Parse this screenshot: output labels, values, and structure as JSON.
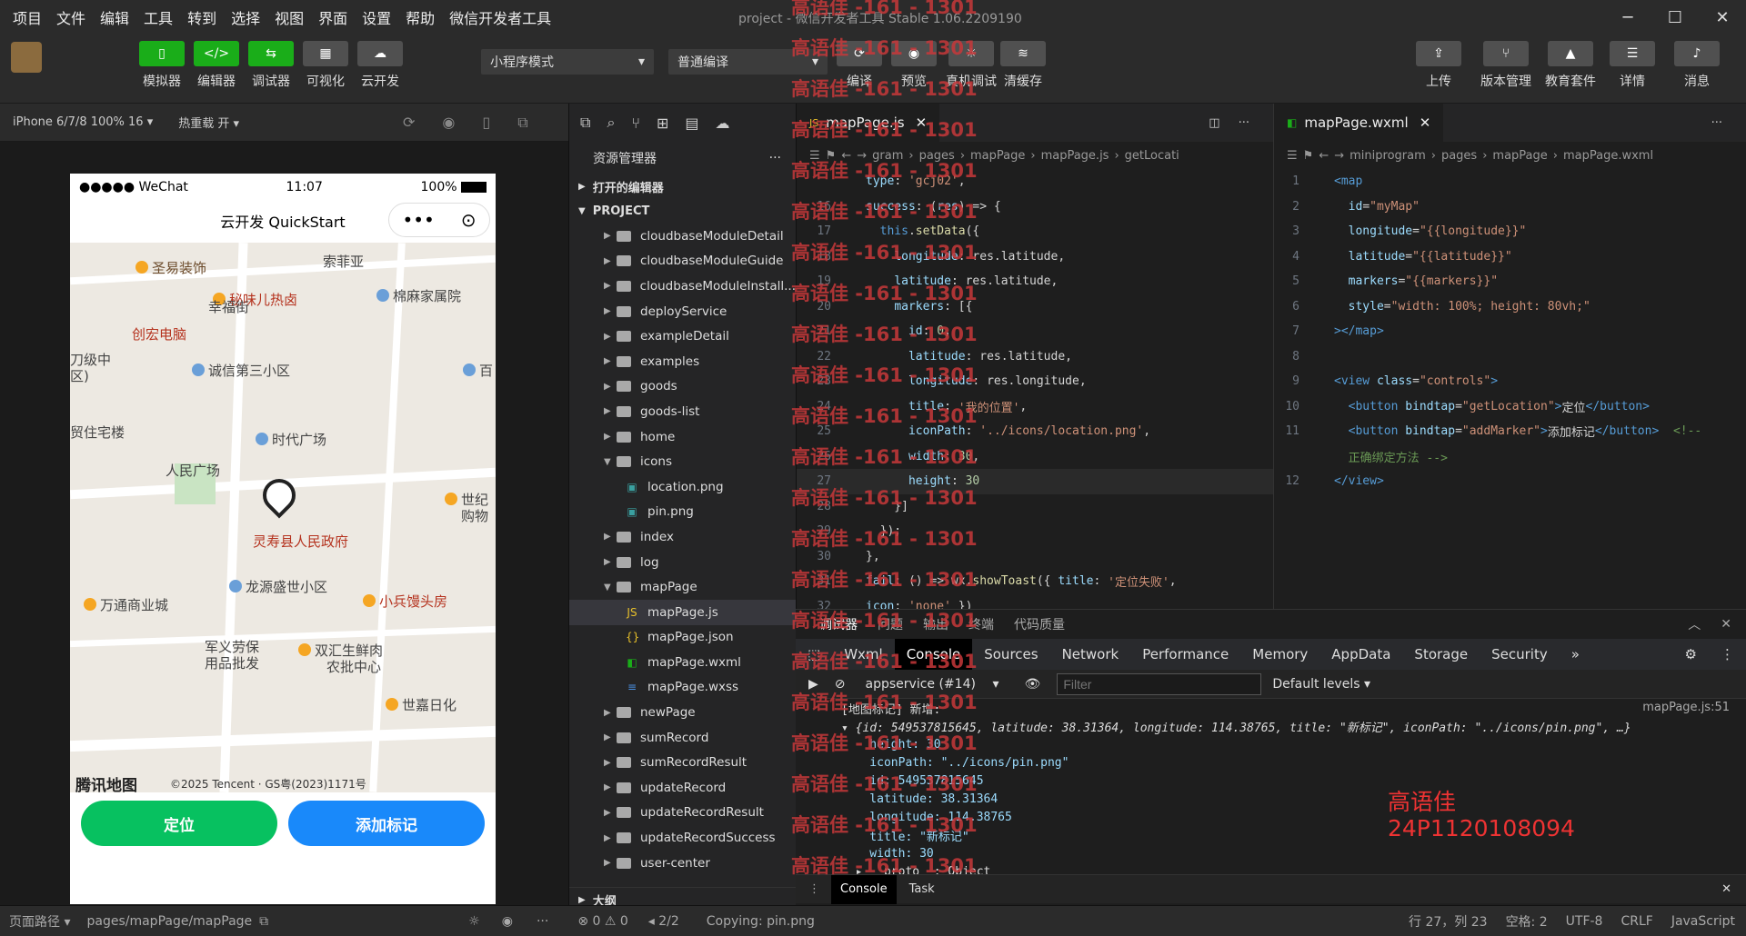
{
  "menubar": {
    "items": [
      "项目",
      "文件",
      "编辑",
      "工具",
      "转到",
      "选择",
      "视图",
      "界面",
      "设置",
      "帮助",
      "微信开发者工具"
    ],
    "window_title": "project - 微信开发者工具 Stable 1.06.2209190"
  },
  "toolbar": {
    "left_buttons": [
      {
        "label": "模拟器",
        "icon": "phone-icon"
      },
      {
        "label": "编辑器",
        "icon": "code-icon"
      },
      {
        "label": "调试器",
        "icon": "debug-icon"
      },
      {
        "label": "可视化",
        "icon": "layout-icon"
      },
      {
        "label": "云开发",
        "icon": "cloud-icon"
      }
    ],
    "mode_select": "小程序模式",
    "compile_select": "普通编译",
    "middle_buttons": [
      {
        "label": "编译",
        "icon": "refresh-icon"
      },
      {
        "label": "预览",
        "icon": "eye-icon"
      },
      {
        "label": "真机调试",
        "icon": "bug-icon"
      },
      {
        "label": "清缓存",
        "icon": "layers-icon"
      }
    ],
    "right_buttons": [
      {
        "label": "上传",
        "icon": "upload-icon"
      },
      {
        "label": "版本管理",
        "icon": "branch-icon"
      },
      {
        "label": "教育套件",
        "icon": "cap-icon"
      },
      {
        "label": "详情",
        "icon": "menu-icon"
      },
      {
        "label": "消息",
        "icon": "bell-icon"
      }
    ]
  },
  "simulator": {
    "device": "iPhone 6/7/8 100% 16 ▾",
    "hot_reload": "热重载 开 ▾",
    "status_left": "●●●●● WeChat",
    "status_time": "11:07",
    "status_batt": "100%",
    "nav_title": "云开发 QuickStart",
    "map_pois": [
      "圣易装饰",
      "索菲亚",
      "秘味儿热卤",
      "棉麻家属院",
      "幸福街",
      "创宏电脑",
      "刀级中",
      "区)",
      "诚信第三小区",
      "百",
      "贸住宅楼",
      "时代广场",
      "人民广场",
      "世纪",
      "购物",
      "灵寿县人民政府",
      "龙源盛世小区",
      "小兵馒头房",
      "万通商业城",
      "军义劳保",
      "用品批发",
      "双汇生鲜肉",
      "农批中心",
      "世嘉日化"
    ],
    "map_logo": "腾讯地图",
    "map_copyright": "©2025 Tencent · GS粤(2023)1171号",
    "btn_locate": "定位",
    "btn_add": "添加标记",
    "btn_locate_color": "#07c160",
    "btn_add_color": "#1989fa"
  },
  "explorer": {
    "title": "资源管理器",
    "open_editors": "打开的编辑器",
    "project": "PROJECT",
    "items": [
      {
        "name": "cloudbaseModuleDetail",
        "type": "folder",
        "indent": 1,
        "arrow": "▶"
      },
      {
        "name": "cloudbaseModuleGuide",
        "type": "folder",
        "indent": 1,
        "arrow": "▶"
      },
      {
        "name": "cloudbaseModuleInstall...",
        "type": "folder",
        "indent": 1,
        "arrow": "▶"
      },
      {
        "name": "deployService",
        "type": "folder",
        "indent": 1,
        "arrow": "▶"
      },
      {
        "name": "exampleDetail",
        "type": "folder",
        "indent": 1,
        "arrow": "▶"
      },
      {
        "name": "examples",
        "type": "folder",
        "indent": 1,
        "arrow": "▶"
      },
      {
        "name": "goods",
        "type": "folder",
        "indent": 1,
        "arrow": "▶"
      },
      {
        "name": "goods-list",
        "type": "folder",
        "indent": 1,
        "arrow": "▶"
      },
      {
        "name": "home",
        "type": "folder",
        "indent": 1,
        "arrow": "▶"
      },
      {
        "name": "icons",
        "type": "folder",
        "indent": 1,
        "arrow": "▼"
      },
      {
        "name": "location.png",
        "type": "img",
        "indent": 2,
        "arrow": ""
      },
      {
        "name": "pin.png",
        "type": "img",
        "indent": 2,
        "arrow": ""
      },
      {
        "name": "index",
        "type": "folder",
        "indent": 1,
        "arrow": "▶"
      },
      {
        "name": "log",
        "type": "folder",
        "indent": 1,
        "arrow": "▶"
      },
      {
        "name": "mapPage",
        "type": "folder",
        "indent": 1,
        "arrow": "▼"
      },
      {
        "name": "mapPage.js",
        "type": "js",
        "indent": 2,
        "arrow": ""
      },
      {
        "name": "mapPage.json",
        "type": "json",
        "indent": 2,
        "arrow": ""
      },
      {
        "name": "mapPage.wxml",
        "type": "wxml",
        "indent": 2,
        "arrow": ""
      },
      {
        "name": "mapPage.wxss",
        "type": "wxss",
        "indent": 2,
        "arrow": ""
      },
      {
        "name": "newPage",
        "type": "folder",
        "indent": 1,
        "arrow": "▶"
      },
      {
        "name": "sumRecord",
        "type": "folder",
        "indent": 1,
        "arrow": "▶"
      },
      {
        "name": "sumRecordResult",
        "type": "folder",
        "indent": 1,
        "arrow": "▶"
      },
      {
        "name": "updateRecord",
        "type": "folder",
        "indent": 1,
        "arrow": "▶"
      },
      {
        "name": "updateRecordResult",
        "type": "folder",
        "indent": 1,
        "arrow": "▶"
      },
      {
        "name": "updateRecordSuccess",
        "type": "folder",
        "indent": 1,
        "arrow": "▶"
      },
      {
        "name": "user-center",
        "type": "folder",
        "indent": 1,
        "arrow": "▶"
      }
    ],
    "outline": "大纲"
  },
  "editor1": {
    "tab": "mapPage.js",
    "crumbs": [
      "gram",
      "pages",
      "mapPage",
      "mapPage.js",
      "getLocati"
    ],
    "lines": [
      {
        "n": "",
        "code": [
          [
            "prop",
            "type"
          ],
          [
            "txt",
            ": "
          ],
          [
            "str",
            "'gcj02'"
          ],
          [
            "txt",
            ","
          ]
        ]
      },
      {
        "n": "16",
        "code": [
          [
            "prop",
            "success"
          ],
          [
            "txt",
            ": ("
          ],
          [
            "prop",
            "res"
          ],
          [
            "txt",
            ") => {"
          ]
        ]
      },
      {
        "n": "17",
        "code": [
          [
            "txt",
            "  "
          ],
          [
            "kw",
            "this"
          ],
          [
            "txt",
            "."
          ],
          [
            "fn",
            "setData"
          ],
          [
            "txt",
            "({"
          ]
        ]
      },
      {
        "n": "18",
        "code": [
          [
            "txt",
            "    "
          ],
          [
            "prop",
            "longitude"
          ],
          [
            "txt",
            ": res.latitude,"
          ]
        ]
      },
      {
        "n": "19",
        "code": [
          [
            "txt",
            "    "
          ],
          [
            "prop",
            "latitude"
          ],
          [
            "txt",
            ": res.latitude,"
          ]
        ]
      },
      {
        "n": "20",
        "code": [
          [
            "txt",
            "    "
          ],
          [
            "prop",
            "markers"
          ],
          [
            "txt",
            ": [{"
          ]
        ]
      },
      {
        "n": "21",
        "code": [
          [
            "txt",
            "      "
          ],
          [
            "prop",
            "id"
          ],
          [
            "txt",
            ": "
          ],
          [
            "num",
            "0"
          ],
          [
            "txt",
            ","
          ]
        ]
      },
      {
        "n": "22",
        "code": [
          [
            "txt",
            "      "
          ],
          [
            "prop",
            "latitude"
          ],
          [
            "txt",
            ": res.latitude,"
          ]
        ]
      },
      {
        "n": "23",
        "code": [
          [
            "txt",
            "      "
          ],
          [
            "prop",
            "longitude"
          ],
          [
            "txt",
            ": res.longitude,"
          ]
        ]
      },
      {
        "n": "24",
        "code": [
          [
            "txt",
            "      "
          ],
          [
            "prop",
            "title"
          ],
          [
            "txt",
            ": "
          ],
          [
            "str",
            "'我的位置'"
          ],
          [
            "txt",
            ","
          ]
        ]
      },
      {
        "n": "25",
        "code": [
          [
            "txt",
            "      "
          ],
          [
            "prop",
            "iconPath"
          ],
          [
            "txt",
            ": "
          ],
          [
            "str",
            "'../icons/location.png'"
          ],
          [
            "txt",
            ","
          ]
        ]
      },
      {
        "n": "26",
        "code": [
          [
            "txt",
            "      "
          ],
          [
            "prop",
            "width"
          ],
          [
            "txt",
            ": "
          ],
          [
            "num",
            "30"
          ],
          [
            "txt",
            ","
          ]
        ]
      },
      {
        "n": "27",
        "code": [
          [
            "txt",
            "      "
          ],
          [
            "prop",
            "height"
          ],
          [
            "txt",
            ": "
          ],
          [
            "num",
            "30"
          ]
        ]
      },
      {
        "n": "28",
        "code": [
          [
            "txt",
            "    }]"
          ]
        ]
      },
      {
        "n": "29",
        "code": [
          [
            "txt",
            "  });"
          ]
        ]
      },
      {
        "n": "30",
        "code": [
          [
            "txt",
            "},"
          ]
        ]
      },
      {
        "n": "31",
        "code": [
          [
            "prop",
            "fail"
          ],
          [
            "txt",
            ": () => wx."
          ],
          [
            "fn",
            "showToast"
          ],
          [
            "txt",
            "({ "
          ],
          [
            "prop",
            "title"
          ],
          [
            "txt",
            ": "
          ],
          [
            "str",
            "'定位失败'"
          ],
          [
            "txt",
            ","
          ]
        ]
      },
      {
        "n": "32",
        "code": [
          [
            "prop",
            "icon"
          ],
          [
            "txt",
            ": "
          ],
          [
            "str",
            "'none'"
          ],
          [
            "txt",
            " })"
          ]
        ]
      }
    ]
  },
  "editor2": {
    "tab": "mapPage.wxml",
    "crumbs": [
      "miniprogram",
      "pages",
      "mapPage",
      "mapPage.wxml"
    ],
    "lines": [
      {
        "n": "1",
        "code": [
          [
            "tag",
            "<map"
          ]
        ]
      },
      {
        "n": "2",
        "code": [
          [
            "txt",
            "  "
          ],
          [
            "attr",
            "id"
          ],
          [
            "txt",
            "="
          ],
          [
            "str",
            "\"myMap\""
          ]
        ]
      },
      {
        "n": "3",
        "code": [
          [
            "txt",
            "  "
          ],
          [
            "attr",
            "longitude"
          ],
          [
            "txt",
            "="
          ],
          [
            "str",
            "\"{{longitude}}\""
          ]
        ]
      },
      {
        "n": "4",
        "code": [
          [
            "txt",
            "  "
          ],
          [
            "attr",
            "latitude"
          ],
          [
            "txt",
            "="
          ],
          [
            "str",
            "\"{{latitude}}\""
          ]
        ]
      },
      {
        "n": "5",
        "code": [
          [
            "txt",
            "  "
          ],
          [
            "attr",
            "markers"
          ],
          [
            "txt",
            "="
          ],
          [
            "str",
            "\"{{markers}}\""
          ]
        ]
      },
      {
        "n": "6",
        "code": [
          [
            "txt",
            "  "
          ],
          [
            "attr",
            "style"
          ],
          [
            "txt",
            "="
          ],
          [
            "str",
            "\"width: 100%; height: 80vh;\""
          ]
        ]
      },
      {
        "n": "7",
        "code": [
          [
            "tag",
            "></map>"
          ]
        ]
      },
      {
        "n": "8",
        "code": [
          [
            "txt",
            ""
          ]
        ]
      },
      {
        "n": "9",
        "code": [
          [
            "tag",
            "<view "
          ],
          [
            "attr",
            "class"
          ],
          [
            "txt",
            "="
          ],
          [
            "str",
            "\"controls\""
          ],
          [
            "tag",
            ">"
          ]
        ]
      },
      {
        "n": "10",
        "code": [
          [
            "txt",
            "  "
          ],
          [
            "tag",
            "<button "
          ],
          [
            "attr",
            "bindtap"
          ],
          [
            "txt",
            "="
          ],
          [
            "str",
            "\"getLocation\""
          ],
          [
            "tag",
            ">"
          ],
          [
            "txt",
            "定位"
          ],
          [
            "tag",
            "</button>"
          ]
        ]
      },
      {
        "n": "11",
        "code": [
          [
            "txt",
            "  "
          ],
          [
            "tag",
            "<button "
          ],
          [
            "attr",
            "bindtap"
          ],
          [
            "txt",
            "="
          ],
          [
            "str",
            "\"addMarker\""
          ],
          [
            "tag",
            ">"
          ],
          [
            "txt",
            "添加标记"
          ],
          [
            "tag",
            "</button>"
          ],
          [
            "cmt",
            "  <!--"
          ]
        ]
      },
      {
        "n": "",
        "code": [
          [
            "cmt",
            "  正确绑定方法 -->"
          ]
        ]
      },
      {
        "n": "12",
        "code": [
          [
            "tag",
            "</view>"
          ]
        ]
      }
    ]
  },
  "debug": {
    "top_tabs": [
      "调试器",
      "问题",
      "输出",
      "终端",
      "代码质量"
    ],
    "devtools_tabs": [
      "Wxml",
      "Console",
      "Sources",
      "Network",
      "Performance",
      "Memory",
      "AppData",
      "Storage",
      "Security",
      "»"
    ],
    "context": "appservice (#14)",
    "filter_placeholder": "Filter",
    "levels": "Default levels ▾",
    "file_ref": "mapPage.js:51",
    "console_lines": [
      "[地图标记] 新增:",
      "▾ {id: 549537815645, latitude: 38.31364, longitude: 114.38765, title: \"新标记\", iconPath: \"../icons/pin.png\", …}",
      "    height: 30",
      "    iconPath: \"../icons/pin.png\"",
      "    id: 549537815645",
      "    latitude: 38.31364",
      "    longitude: 114.38765",
      "    title: \"新标记\"",
      "    width: 30",
      "  ▸ __proto__: Object"
    ],
    "bottom_tabs": [
      "Console",
      "Task"
    ],
    "name_label": "高语佳",
    "id_label": "24P1120108094"
  },
  "statusbar": {
    "page_path_label": "页面路径 ▾",
    "page_path": "pages/mapPage/mapPage",
    "errors": "⊗ 0 ⚠ 0",
    "nav": "◂ 2/2",
    "copying": "Copying: pin.png",
    "position": "行 27，列 23",
    "spaces": "空格: 2",
    "encoding": "UTF-8",
    "eol": "CRLF",
    "lang": "JavaScript"
  },
  "watermark": "高语佳 -161 - 1301"
}
